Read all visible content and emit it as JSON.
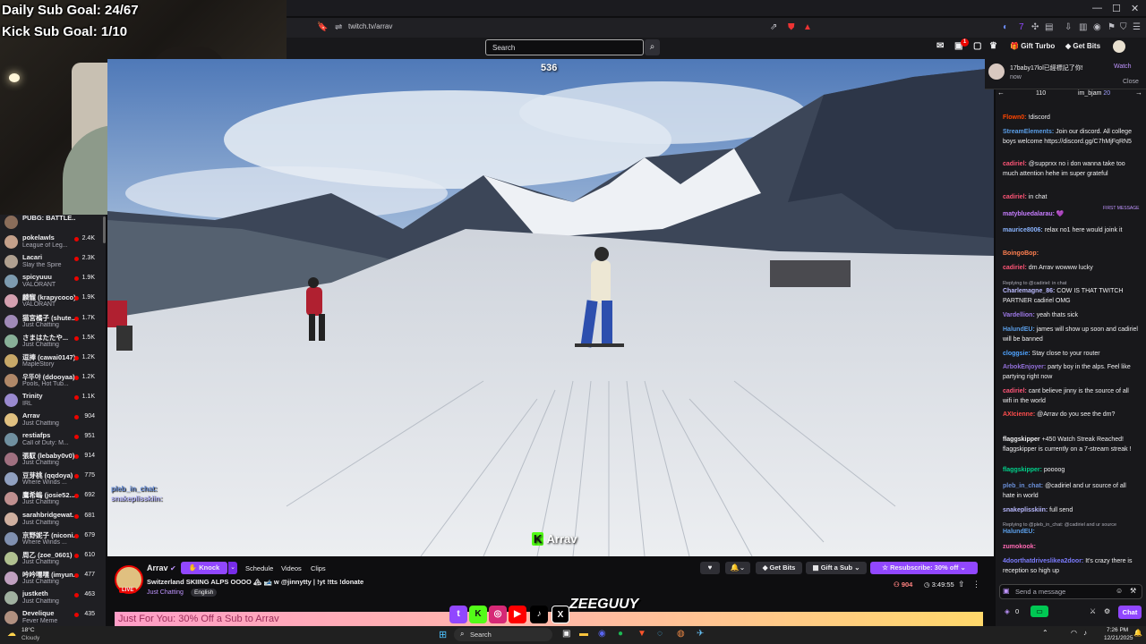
{
  "overlay": {
    "daily_goal": "Daily Sub Goal: 24/67",
    "kick_goal": "Kick Sub Goal: 1/10",
    "video_counter": "536",
    "kick_name": "Arrav"
  },
  "browser": {
    "url": "twitch.tv/arrav"
  },
  "topnav": {
    "search_placeholder": "Search",
    "notification_count": "1",
    "gift_turbo": "Gift Turbo",
    "get_bits": "Get Bits"
  },
  "notification": {
    "text": "17baby17lol已經標記了你!",
    "time": "now",
    "watch": "Watch",
    "close": "Close"
  },
  "sidebar": {
    "items": [
      {
        "name": "PUBG: BATTLE...",
        "game": "",
        "viewers": ""
      },
      {
        "name": "pokelawls",
        "game": "League of Leg...",
        "viewers": "2.4K"
      },
      {
        "name": "Lacari",
        "game": "Slay the Spire",
        "viewers": "2.3K"
      },
      {
        "name": "spicyuuu",
        "game": "VALORANT",
        "viewers": "1.9K"
      },
      {
        "name": "麟寵 (krapycoco)",
        "game": "VALORANT",
        "viewers": "1.9K"
      },
      {
        "name": "猫宮橘子 (shute...",
        "game": "Just Chatting",
        "viewers": "1.7K"
      },
      {
        "name": "さまはたたや...",
        "game": "Just Chatting",
        "viewers": "1.5K"
      },
      {
        "name": "逗捧 (cawai0147)",
        "game": "MapleStory",
        "viewers": "1.2K"
      },
      {
        "name": "우뚜야 (ddooyaa)",
        "game": "Pools, Hot Tub...",
        "viewers": "1.2K"
      },
      {
        "name": "Trinity",
        "game": "IRL",
        "viewers": "1.1K"
      },
      {
        "name": "Arrav",
        "game": "Just Chatting",
        "viewers": "904"
      },
      {
        "name": "restiafps",
        "game": "Call of Duty: M...",
        "viewers": "951"
      },
      {
        "name": "張馭 (lebaby0v0)",
        "game": "Just Chatting",
        "viewers": "914"
      },
      {
        "name": "豆芽桃 (qqdoya)",
        "game": "Where Winds ...",
        "viewers": "775"
      },
      {
        "name": "鷹希嶋 (josie52...",
        "game": "Just Chatting",
        "viewers": "692"
      },
      {
        "name": "sarahbridgewat...",
        "game": "Just Chatting",
        "viewers": "681"
      },
      {
        "name": "京野妮子 (niconi...",
        "game": "Where Winds ...",
        "viewers": "679"
      },
      {
        "name": "周乙 (zoe_0601)",
        "game": "Just Chatting",
        "viewers": "610"
      },
      {
        "name": "吟吟嘿嘿 (imyun...",
        "game": "Just Chatting",
        "viewers": "477"
      },
      {
        "name": "justketh",
        "game": "Just Chatting",
        "viewers": "463"
      },
      {
        "name": "Develique",
        "game": "Fever Meme",
        "viewers": "435"
      }
    ]
  },
  "video_chat_overlay": [
    {
      "u": "pleb_in_chat:",
      "t": "...",
      "color": "#6a8fd8"
    },
    {
      "u": "snakeplisskiin:",
      "t": "...",
      "color": "#b8b8ff"
    }
  ],
  "stream": {
    "channel": "Arrav",
    "knock": "Knock",
    "tabs": [
      "Schedule",
      "Videos",
      "Clips"
    ],
    "title": "Switzerland SKIING ALPS OOOO 🏔 🎿 w @jinnytty | !yt !tts !donate",
    "category": "Just Chatting",
    "tag": "English",
    "live": "LIVE",
    "get_bits": "Get Bits",
    "gift_a_sub": "Gift a Sub",
    "resubscribe": "Resubscribe: 30% off",
    "viewers": "904",
    "uptime": "3:49:55",
    "banner": "Just For You: 30% Off a Sub to Arrav"
  },
  "chat": {
    "top_user_1": "110",
    "top_user_2": "im_bjam",
    "top_user_2_count": "20",
    "messages": [
      {
        "u": "Flown0:",
        "t": " !discord",
        "c": "#ff4500"
      },
      {
        "u": "StreamElements:",
        "t": " Join our discord. All college boys welcome https://discord.gg/C7hMjFqRN5",
        "c": "#5a9ee8"
      },
      {
        "u": "cadiriel:",
        "t": " @supprxx no i don wanna take too much attention hehe im super grateful",
        "c": "#ff5577"
      },
      {
        "u": "cadiriel:",
        "t": " in chat",
        "c": "#ff5577"
      },
      {
        "u": "matybluedalarau:",
        "t": " 💜",
        "c": "#c77dff"
      },
      {
        "u": "maurice8006:",
        "t": " relax no1 here would joink it",
        "c": "#8ab4ff"
      },
      {
        "u": "BoingoBop:",
        "t": "",
        "c": "#ff7f50"
      },
      {
        "u": "cadiriel:",
        "t": " dm Arrav wowww lucky",
        "c": "#ff5577"
      },
      {
        "u": "Charlemagne_86:",
        "t": " COW IS THAT TWITCH PARTNER cadiriel OMG",
        "c": "#bbbbff"
      },
      {
        "u": "Vardellion:",
        "t": " yeah thats sick",
        "c": "#9f7aea"
      },
      {
        "u": "HalundEU:",
        "t": " james will show up soon and cadiriel will be banned",
        "c": "#5a9ee8"
      },
      {
        "u": "cloggsie:",
        "t": " Stay close to your router",
        "c": "#4fa3ff"
      },
      {
        "u": "ArbokEnjoyer:",
        "t": " party boy in the alps. Feel like partying right now",
        "c": "#9370db"
      },
      {
        "u": "cadiriel:",
        "t": " cant believe jinny is the source of all wifi in the world",
        "c": "#ff5577"
      },
      {
        "u": "AXIcienne:",
        "t": " @Arrav do you see the dm?",
        "c": "#ff4d4d"
      },
      {
        "u": "flaggskipper",
        "t": " +450 Watch Streak Reached! flaggskipper is currently on a 7-stream streak !",
        "c": "#efeff1"
      },
      {
        "u": "flaggskipper:",
        "t": " poooog",
        "c": "#00d18b"
      },
      {
        "u": "pleb_in_chat:",
        "t": " @cadiriel and ur source of all hate in world",
        "c": "#6a8fd8"
      },
      {
        "u": "snakeplisskiin:",
        "t": " full send",
        "c": "#b8b8ff"
      },
      {
        "u": "HalundEU:",
        "t": "",
        "c": "#5a9ee8"
      },
      {
        "u": "zumokook:",
        "t": "",
        "c": "#ff69b4"
      },
      {
        "u": "4doorthatdriveslikea2door:",
        "t": " It's crazy there is reception so high up",
        "c": "#7c7cff"
      }
    ],
    "reply_1": "Replying to @cadiriel: in chat",
    "reply_2": "Replying to @pleb_in_chat: @cadiriel and ur source",
    "pinned_label": "FIRST MESSAGE",
    "input_placeholder": "Send a message",
    "points": "0",
    "chat_button": "Chat"
  },
  "taskbar": {
    "weather_temp": "18°C",
    "weather_desc": "Cloudy",
    "search": "Search",
    "time": "7:26 PM",
    "date": "12/21/2025"
  },
  "colors": {
    "twitch_purple": "#9147ff",
    "live_red": "#eb0400",
    "kick_green": "#53fc18"
  }
}
